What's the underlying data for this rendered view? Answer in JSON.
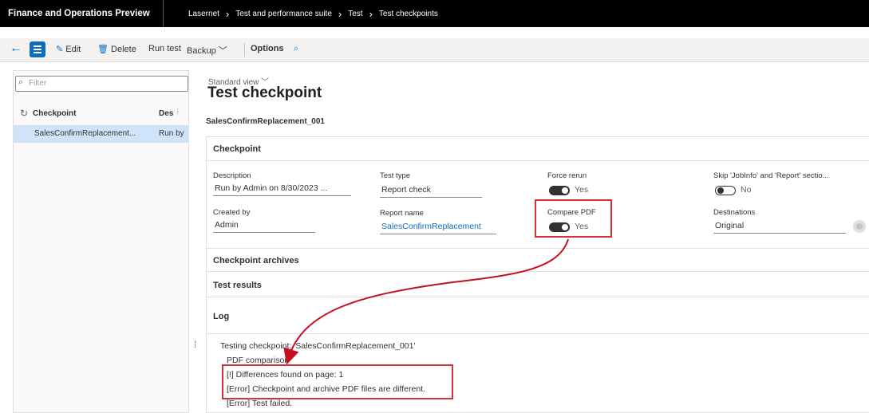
{
  "topbar": {
    "app_title": "Finance and Operations Preview",
    "breadcrumbs": [
      "Lasernet",
      "Test and performance suite",
      "Test",
      "Test checkpoints"
    ]
  },
  "actionbar": {
    "edit": "Edit",
    "delete": "Delete",
    "run_test": "Run test",
    "backup": "Backup",
    "options": "Options"
  },
  "leftpane": {
    "filter_placeholder": "Filter",
    "col_checkpoint": "Checkpoint",
    "col_description": "Des",
    "row_checkpoint": "SalesConfirmReplacement...",
    "row_description": "Run by"
  },
  "main": {
    "view_label": "Standard view",
    "page_title": "Test checkpoint",
    "record_id": "SalesConfirmReplacement_001",
    "checkpoint_section": "Checkpoint",
    "fields": {
      "description_label": "Description",
      "description_value": "Run by Admin on 8/30/2023 ...",
      "test_type_label": "Test type",
      "test_type_value": "Report check",
      "force_rerun_label": "Force rerun",
      "force_rerun_value": "Yes",
      "skip_label": "Skip 'JobInfo' and 'Report' sectio...",
      "skip_value": "No",
      "created_by_label": "Created by",
      "created_by_value": "Admin",
      "report_name_label": "Report name",
      "report_name_value": "SalesConfirmReplacement",
      "compare_pdf_label": "Compare PDF",
      "compare_pdf_value": "Yes",
      "destinations_label": "Destinations",
      "destinations_value": "Original"
    },
    "archives_section": "Checkpoint archives",
    "results_section": "Test results",
    "log_section": "Log",
    "log_lines": [
      "Testing checkpoint: 'SalesConfirmReplacement_001'",
      "PDF comparison",
      "[!] Differences found on page: 1",
      "[Error] Checkpoint and archive PDF files are different.",
      "[Error] Test failed."
    ]
  },
  "colors": {
    "accent": "#0f6cbd",
    "highlight": "#d13438",
    "selected_row": "#cfe4fa"
  }
}
